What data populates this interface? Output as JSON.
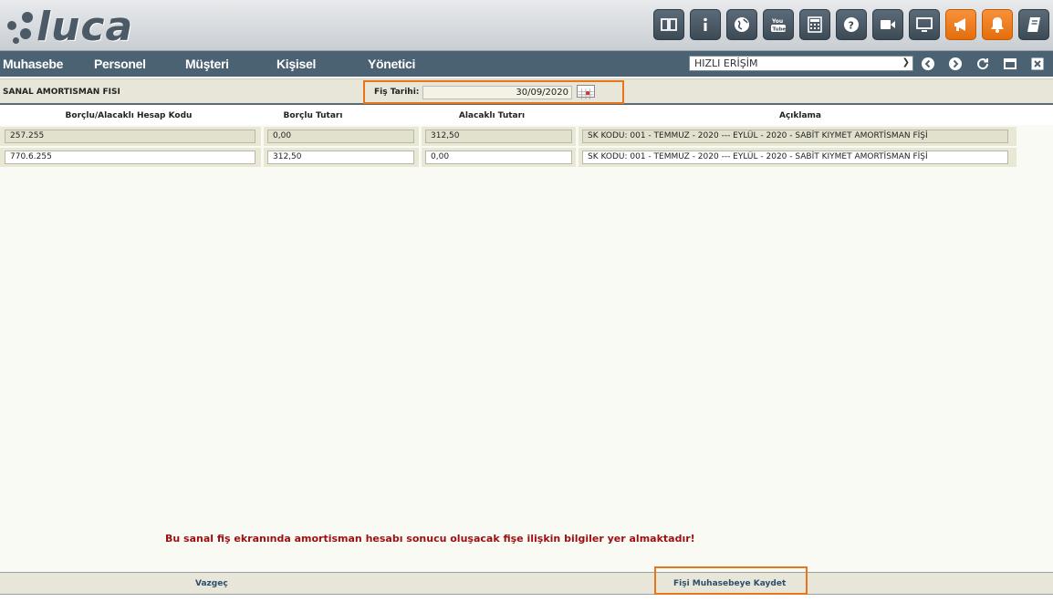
{
  "app": {
    "logo_text": "luca"
  },
  "toolbar": {
    "icons": [
      "book-icon",
      "info-icon",
      "globe-icon",
      "youtube-icon",
      "calculator-icon",
      "help-icon",
      "video-icon",
      "monitor-icon",
      "megaphone-icon",
      "bell-icon",
      "notebook-icon"
    ]
  },
  "nav": {
    "items": [
      "Muhasebe",
      "Personel",
      "Müşteri",
      "Kişisel",
      "Yönetici"
    ],
    "quick_access": "HIZLI ERİŞİM"
  },
  "page": {
    "title": "SANAL AMORTISMAN FISI",
    "date_label": "Fiş Tarihi:",
    "date_value": "30/09/2020"
  },
  "table": {
    "headers": [
      "Borçlu/Alacaklı Hesap Kodu",
      "Borçlu Tutarı",
      "Alacaklı Tutarı",
      "Açıklama"
    ],
    "rows": [
      {
        "code": "257.255",
        "debit": "0,00",
        "credit": "312,50",
        "desc": "SK KODU: 001 - TEMMUZ - 2020 --- EYLÜL - 2020 - SABİT KIYMET AMORTİSMAN FİŞİ"
      },
      {
        "code": "770.6.255",
        "debit": "312,50",
        "credit": "0,00",
        "desc": "SK KODU: 001 - TEMMUZ - 2020 --- EYLÜL - 2020 - SABİT KIYMET AMORTİSMAN FİŞİ"
      }
    ]
  },
  "notice": "Bu sanal fiş ekranında amortisman hesabı sonucu oluşacak fişe ilişkin bilgiler yer almaktadır!",
  "footer": {
    "cancel_label": "Vazgeç",
    "save_label": "Fişi Muhasebeye Kaydet"
  },
  "colors": {
    "accent": "#e8751a",
    "nav": "#4b6272",
    "notice": "#9a1010"
  }
}
